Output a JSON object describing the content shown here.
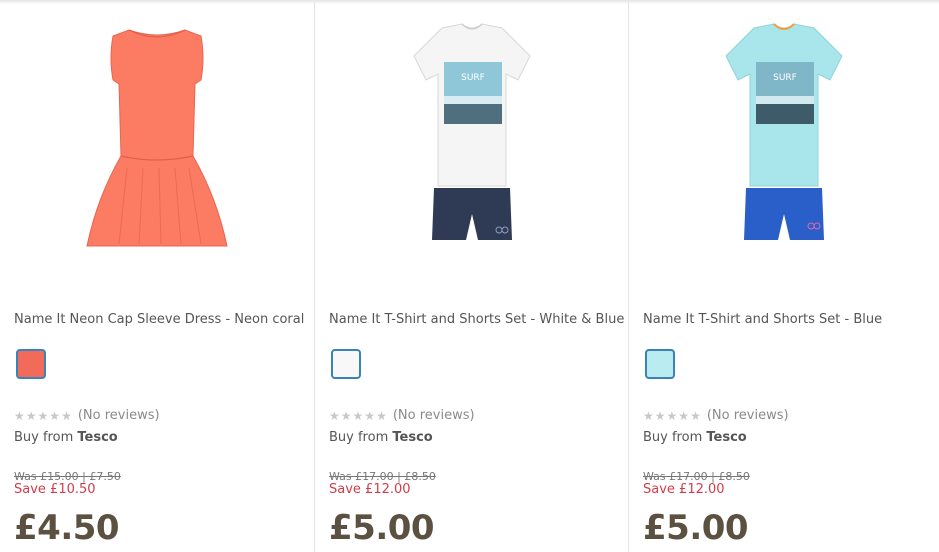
{
  "products": [
    {
      "name": "Name It Neon Cap Sleeve Dress - Neon coral",
      "swatch_color": "#f26b5a",
      "image_icon": "dress-icon",
      "garment_color": "#fb7b63",
      "reviews": "(No reviews)",
      "buy_prefix": "Buy from",
      "retailer": "Tesco",
      "was_price": "Was £15.00 | £7.50",
      "save": "Save £10.50",
      "price": "£4.50"
    },
    {
      "name": "Name It T-Shirt and Shorts Set - White & Blue",
      "swatch_color": "#f8f8f8",
      "image_icon": "tshirt-shorts-icon",
      "shirt_color": "#f5f5f5",
      "shorts_color": "#2f3a55",
      "reviews": "(No reviews)",
      "buy_prefix": "Buy from",
      "retailer": "Tesco",
      "was_price": "Was £17.00 | £8.50",
      "save": "Save £12.00",
      "price": "£5.00"
    },
    {
      "name": "Name It T-Shirt and Shorts Set - Blue",
      "swatch_color": "#b9ecf0",
      "image_icon": "tshirt-shorts-icon",
      "shirt_color": "#a8e6ec",
      "shorts_color": "#2a5ec8",
      "reviews": "(No reviews)",
      "buy_prefix": "Buy from",
      "retailer": "Tesco",
      "was_price": "Was £17.00 | £8.50",
      "save": "Save £12.00",
      "price": "£5.00"
    }
  ],
  "colors": {
    "price": "#5c5041",
    "save": "#d23c4a",
    "swatch_border": "#3a82b8",
    "star_empty": "#c8c8c8"
  }
}
